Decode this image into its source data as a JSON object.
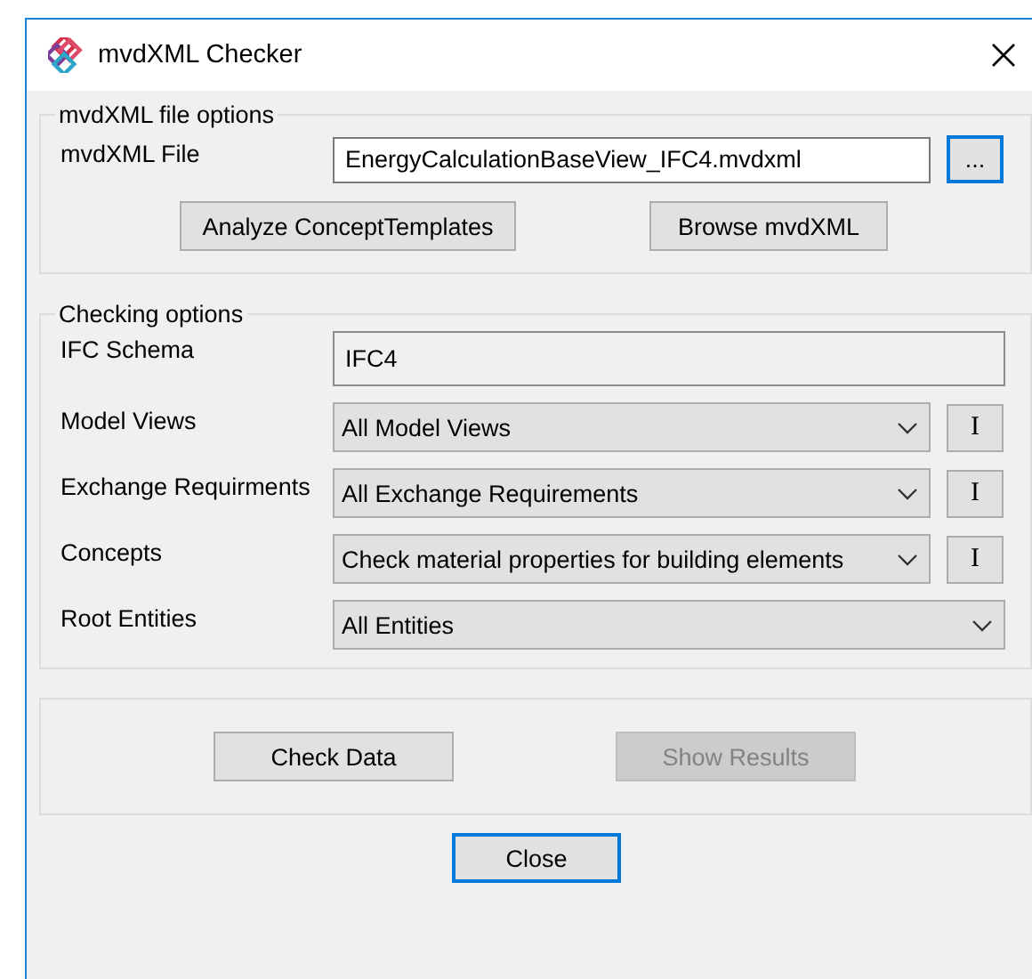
{
  "window": {
    "title": "mvdXML Checker"
  },
  "file_options": {
    "legend": "mvdXML file options",
    "file_label": "mvdXML File",
    "file_value": "EnergyCalculationBaseView_IFC4.mvdxml",
    "browse_button": {
      "label": "...",
      "focused": true
    },
    "buttons": [
      {
        "label": "Analyze ConceptTemplates",
        "disabled": false
      },
      {
        "label": "Browse mvdXML",
        "disabled": false
      }
    ]
  },
  "checking_options": {
    "legend": "Checking options",
    "rows": [
      {
        "kind": "text",
        "label": "IFC Schema",
        "value": "IFC4"
      },
      {
        "kind": "select",
        "label": "Model Views",
        "value": "All Model Views",
        "info_button": "I"
      },
      {
        "kind": "select",
        "label": "Exchange Requirments",
        "value": "All Exchange Requirements",
        "info_button": "I"
      },
      {
        "kind": "select",
        "label": "Concepts",
        "value": "Check material properties for building elements",
        "info_button": "I"
      },
      {
        "kind": "select",
        "label": "Root Entities",
        "value": "All Entities"
      }
    ]
  },
  "actions": [
    {
      "label": "Check Data",
      "disabled": false
    },
    {
      "label": "Show Results",
      "disabled": true
    }
  ],
  "close_button": {
    "label": "Close",
    "focused": true
  }
}
